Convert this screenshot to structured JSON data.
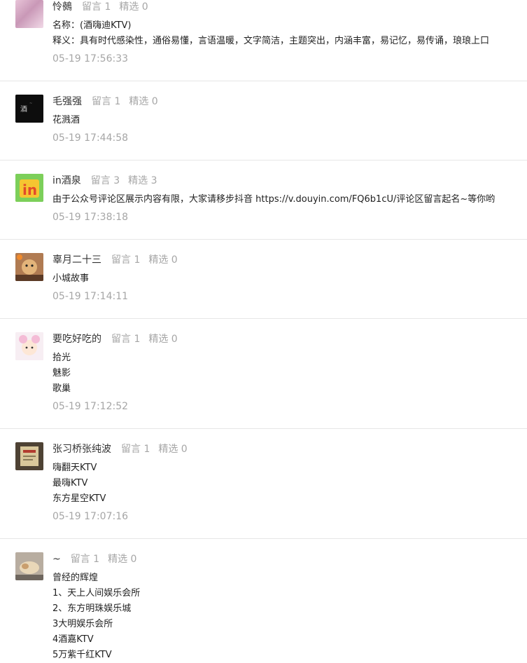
{
  "comments": [
    {
      "username": "怜鵺",
      "reply_label": "留言 1",
      "featured_label": "精选 0",
      "lines": [
        "名称：(酒嗨迪KTV)",
        "释义：具有时代感染性，通俗易懂，言语温暖，文字简洁，主题突出，内涵丰富，易记忆，易传诵，琅琅上口"
      ],
      "time": "05-19 17:56:33"
    },
    {
      "username": "毛强强",
      "reply_label": "留言 1",
      "featured_label": "精选 0",
      "lines": [
        "花溅酒"
      ],
      "time": "05-19 17:44:58"
    },
    {
      "username": "in酒泉",
      "reply_label": "留言 3",
      "featured_label": "精选 3",
      "lines": [
        "由于公众号评论区展示内容有限，大家请移步抖音 https://v.douyin.com/FQ6b1cU/评论区留言起名~等你哟"
      ],
      "time": "05-19 17:38:18"
    },
    {
      "username": "辜月二十三",
      "reply_label": "留言 1",
      "featured_label": "精选 0",
      "lines": [
        "小城故事"
      ],
      "time": "05-19 17:14:11"
    },
    {
      "username": "要吃好吃的",
      "reply_label": "留言 1",
      "featured_label": "精选 0",
      "lines": [
        "拾光",
        "魅影",
        "歌巢"
      ],
      "time": "05-19 17:12:52"
    },
    {
      "username": "张习桥张纯波",
      "reply_label": "留言 1",
      "featured_label": "精选 0",
      "lines": [
        "嗨翻天KTV",
        "最嗨KTV",
        "东方星空KTV"
      ],
      "time": "05-19 17:07:16"
    },
    {
      "username": "~",
      "reply_label": "留言 1",
      "featured_label": "精选 0",
      "lines": [
        "曾经的辉煌",
        "1、天上人间娱乐会所",
        "2、东方明珠娱乐城",
        "3大明娱乐会所",
        "4酒嘉KTV",
        "5万紫千红KTV"
      ],
      "time": ""
    }
  ]
}
